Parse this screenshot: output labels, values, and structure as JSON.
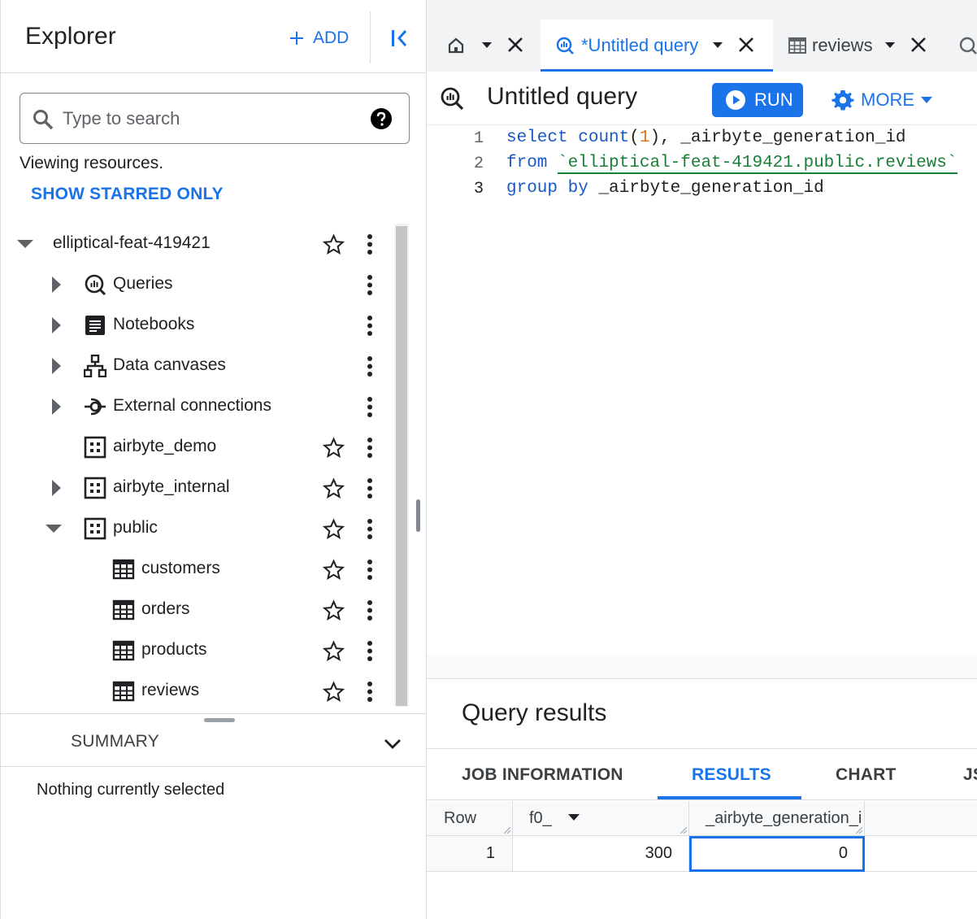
{
  "explorer": {
    "title": "Explorer",
    "add_label": "ADD",
    "search_placeholder": "Type to search",
    "viewing_text": "Viewing resources.",
    "starred_link": "SHOW STARRED ONLY"
  },
  "tree": {
    "project": "elliptical-feat-419421",
    "items": [
      {
        "label": "Queries",
        "icon": "queries-icon"
      },
      {
        "label": "Notebooks",
        "icon": "notebook-icon"
      },
      {
        "label": "Data canvases",
        "icon": "data-canvas-icon"
      },
      {
        "label": "External connections",
        "icon": "connection-icon"
      },
      {
        "label": "airbyte_demo",
        "icon": "dataset-icon"
      },
      {
        "label": "airbyte_internal",
        "icon": "dataset-icon"
      },
      {
        "label": "public",
        "icon": "dataset-icon"
      },
      {
        "label": "customers",
        "icon": "table-icon"
      },
      {
        "label": "orders",
        "icon": "table-icon"
      },
      {
        "label": "products",
        "icon": "table-icon"
      },
      {
        "label": "reviews",
        "icon": "table-icon"
      }
    ]
  },
  "summary": {
    "label": "SUMMARY",
    "empty_text": "Nothing currently selected"
  },
  "tabs": [
    {
      "label": "",
      "icon": "home-icon"
    },
    {
      "label": "*Untitled query",
      "icon": "query-icon",
      "active": true
    },
    {
      "label": "reviews",
      "icon": "table-icon"
    }
  ],
  "query": {
    "title": "Untitled query",
    "run_label": "RUN",
    "more_label": "MORE",
    "lines": [
      {
        "no": "1",
        "kw1": "select",
        "kw2": "count",
        "paren_open": "(",
        "num": "1",
        "rest": "), _airbyte_generation_id"
      },
      {
        "no": "2",
        "kw1": "from",
        "str": "`elliptical-feat-419421.public.reviews`"
      },
      {
        "no": "3",
        "kw1": "group",
        "kw2": "by",
        "rest": "_airbyte_generation_id"
      }
    ]
  },
  "results": {
    "title": "Query results",
    "tabs": [
      "JOB INFORMATION",
      "RESULTS",
      "CHART",
      "JS"
    ],
    "active_tab": "RESULTS",
    "columns": [
      "Row",
      "f0_",
      "_airbyte_generation_i"
    ],
    "rows": [
      [
        "1",
        "300",
        "0"
      ]
    ]
  },
  "colors": {
    "accent": "#1a73e8",
    "keyword": "#1a58c7",
    "string": "#188038",
    "number": "#e8710a"
  }
}
